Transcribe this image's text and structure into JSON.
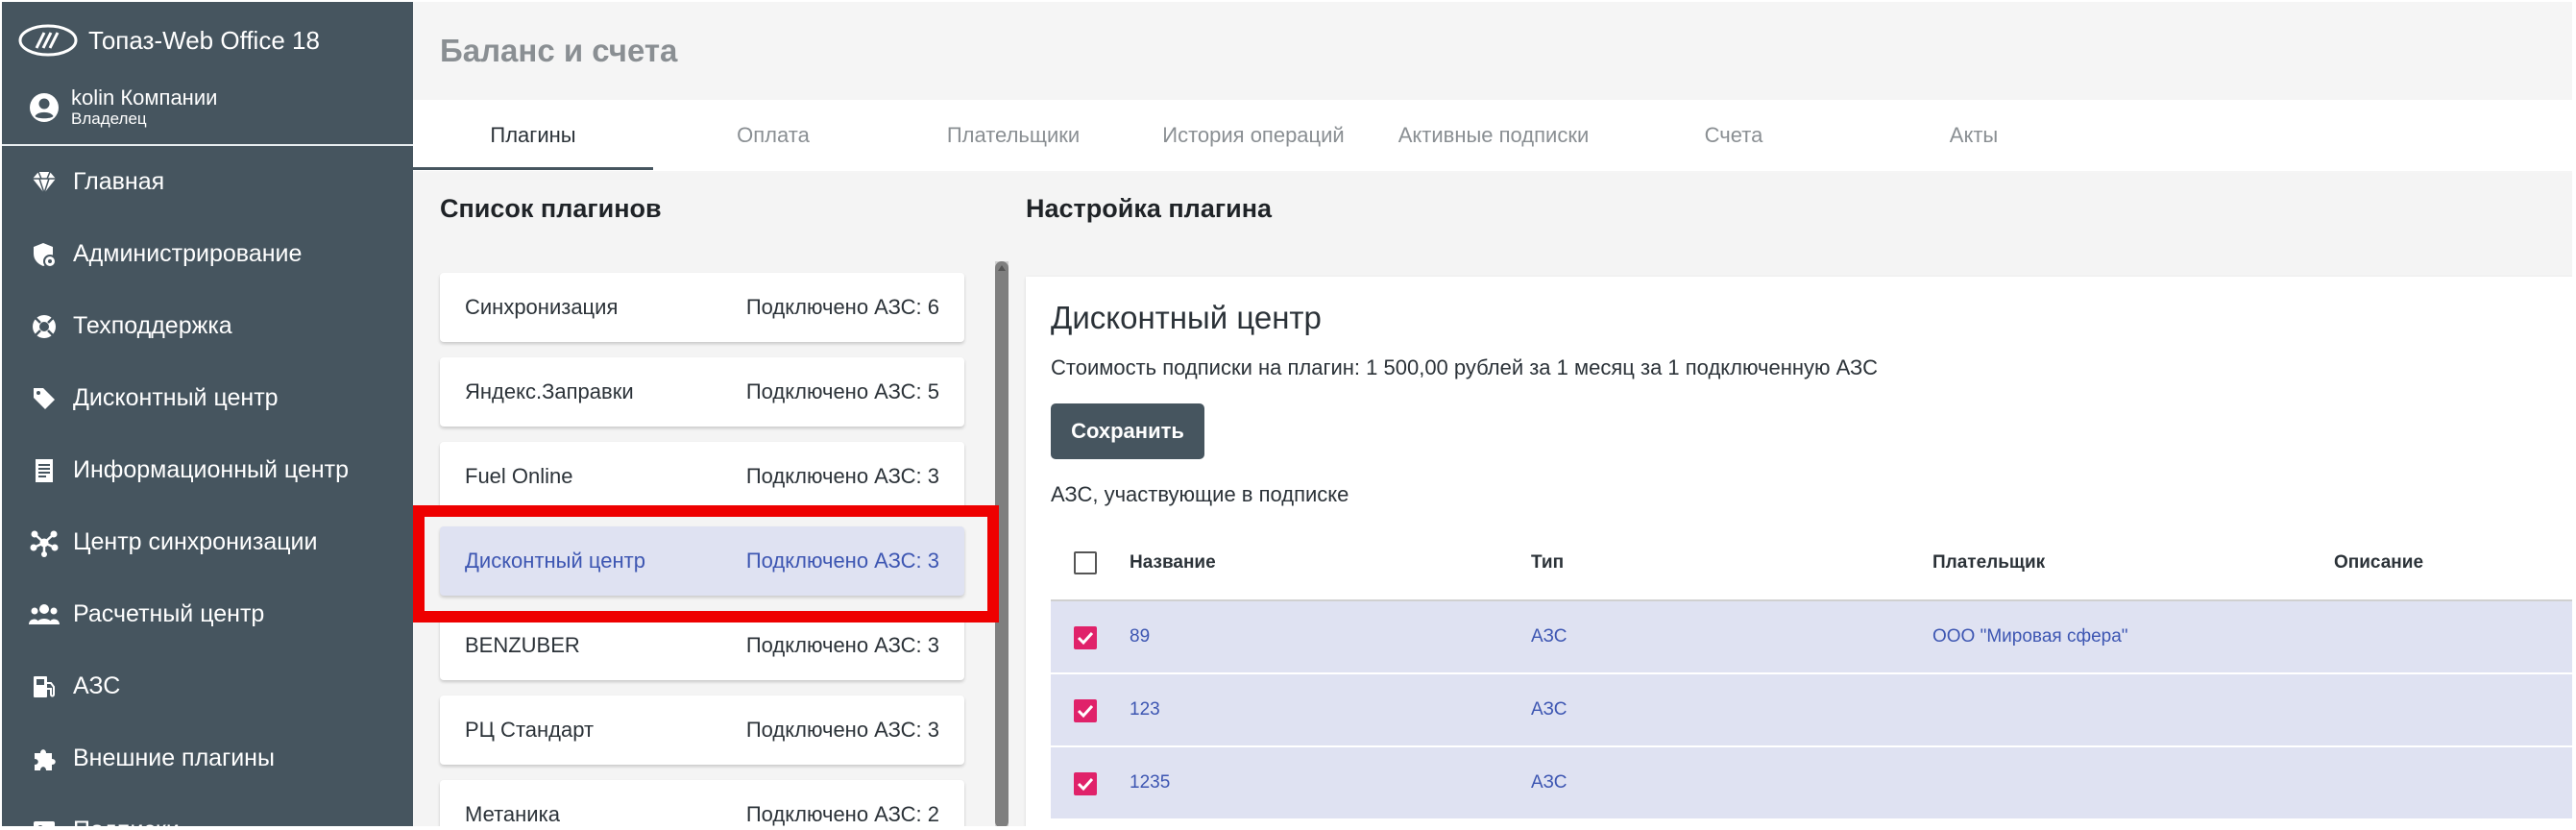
{
  "app": {
    "name": "Топаз-Web Office 18",
    "user_name": "kolin Компании",
    "user_role": "Владелец"
  },
  "sidebar": {
    "items": [
      {
        "label": "Главная",
        "icon": "diamond-icon"
      },
      {
        "label": "Администрирование",
        "icon": "admin-shield-icon"
      },
      {
        "label": "Техподдержка",
        "icon": "lifebuoy-icon"
      },
      {
        "label": "Дисконтный центр",
        "icon": "tag-icon"
      },
      {
        "label": "Информационный центр",
        "icon": "document-icon"
      },
      {
        "label": "Центр синхронизации",
        "icon": "network-icon"
      },
      {
        "label": "Расчетный центр",
        "icon": "people-icon"
      },
      {
        "label": "АЗС",
        "icon": "fuel-pump-icon"
      },
      {
        "label": "Внешние плагины",
        "icon": "puzzle-icon"
      },
      {
        "label": "Подписки",
        "icon": "subscriptions-icon"
      }
    ]
  },
  "page": {
    "title": "Баланс и счета"
  },
  "tabs": [
    {
      "label": "Плагины",
      "active": true
    },
    {
      "label": "Оплата",
      "active": false
    },
    {
      "label": "Плательщики",
      "active": false
    },
    {
      "label": "История операций",
      "active": false
    },
    {
      "label": "Активные подписки",
      "active": false
    },
    {
      "label": "Счета",
      "active": false
    },
    {
      "label": "Акты",
      "active": false
    }
  ],
  "plugins_list": {
    "title": "Список плагинов",
    "items": [
      {
        "name": "Синхронизация",
        "count": "Подключено АЗС: 6",
        "selected": false
      },
      {
        "name": "Яндекс.Заправки",
        "count": "Подключено АЗС: 5",
        "selected": false
      },
      {
        "name": "Fuel Online",
        "count": "Подключено АЗС: 3",
        "selected": false
      },
      {
        "name": "Дисконтный центр",
        "count": "Подключено АЗС: 3",
        "selected": true
      },
      {
        "name": "BENZUBER",
        "count": "Подключено АЗС: 3",
        "selected": false
      },
      {
        "name": "РЦ Стандарт",
        "count": "Подключено АЗС: 3",
        "selected": false
      },
      {
        "name": "Метаника",
        "count": "Подключено АЗС: 2",
        "selected": false
      }
    ]
  },
  "settings": {
    "title": "Настройка плагина",
    "plugin_name": "Дисконтный центр",
    "price_text": "Стоимость подписки на плагин: 1 500,00 рублей за 1 месяц за 1 подключенную АЗС",
    "save_label": "Сохранить",
    "azs_caption": "АЗС, участвующие в подписке",
    "table": {
      "columns": [
        "Название",
        "Тип",
        "Плательщик",
        "Описание"
      ],
      "rows": [
        {
          "name": "89",
          "type": "АЗС",
          "payer": "ООО \"Мировая сфера\"",
          "description": "",
          "checked": true
        },
        {
          "name": "123",
          "type": "АЗС",
          "payer": "",
          "description": "",
          "checked": true
        },
        {
          "name": "1235",
          "type": "АЗС",
          "payer": "",
          "description": "",
          "checked": true
        }
      ]
    }
  },
  "colors": {
    "sidebar_bg": "#46555f",
    "accent_blue": "#3d56b2",
    "selected_bg": "#dfe2f2",
    "checkbox_pink": "#e0226a",
    "highlight_red": "#ee0000"
  }
}
